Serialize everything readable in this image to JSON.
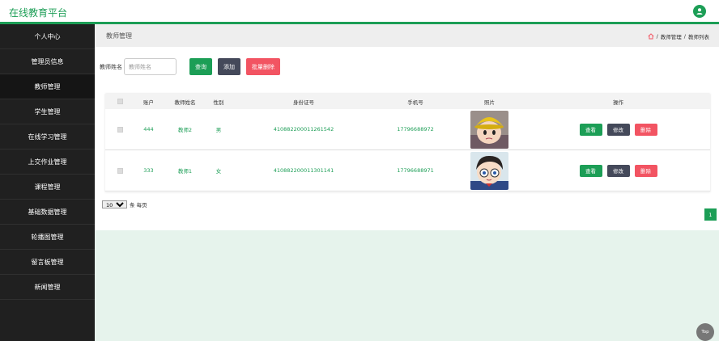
{
  "app": {
    "title": "在线教育平台"
  },
  "sidebar": {
    "items": [
      {
        "label": "个人中心"
      },
      {
        "label": "管理员信息"
      },
      {
        "label": "教师管理"
      },
      {
        "label": "学生管理"
      },
      {
        "label": "在线学习管理"
      },
      {
        "label": "上交作业管理"
      },
      {
        "label": "课程管理"
      },
      {
        "label": "基础数据管理"
      },
      {
        "label": "轮播图管理"
      },
      {
        "label": "留言板管理"
      },
      {
        "label": "新闻管理"
      }
    ]
  },
  "page": {
    "title": "教师管理",
    "breadcrumb": {
      "section": "教师管理",
      "separator": "/",
      "current": "教师列表"
    }
  },
  "search": {
    "label": "教师姓名",
    "placeholder": "教师姓名",
    "query_label": "查询",
    "add_label": "添加",
    "batch_delete_label": "批量删除"
  },
  "table": {
    "headers": [
      "账户",
      "教师姓名",
      "性别",
      "身份证号",
      "手机号",
      "照片",
      "操作"
    ],
    "rows": [
      {
        "account": "444",
        "name": "教师2",
        "gender": "男",
        "id_number": "410882200011261542",
        "phone": "17796688972",
        "photo": "cartoon-boy-yellow-hat"
      },
      {
        "account": "333",
        "name": "教师1",
        "gender": "女",
        "id_number": "410882200011301141",
        "phone": "17796688971",
        "photo": "cartoon-boy-glasses"
      }
    ],
    "actions": {
      "view": "查看",
      "edit": "修改",
      "delete": "删除"
    }
  },
  "pagination": {
    "page_size": "10",
    "per_page_label": "条 每页",
    "current_page": "1"
  },
  "back_to_top": "Top",
  "colors": {
    "accent": "#1c9e56",
    "dark_button": "#44495a",
    "danger": "#f25462",
    "sidebar": "#202020"
  }
}
